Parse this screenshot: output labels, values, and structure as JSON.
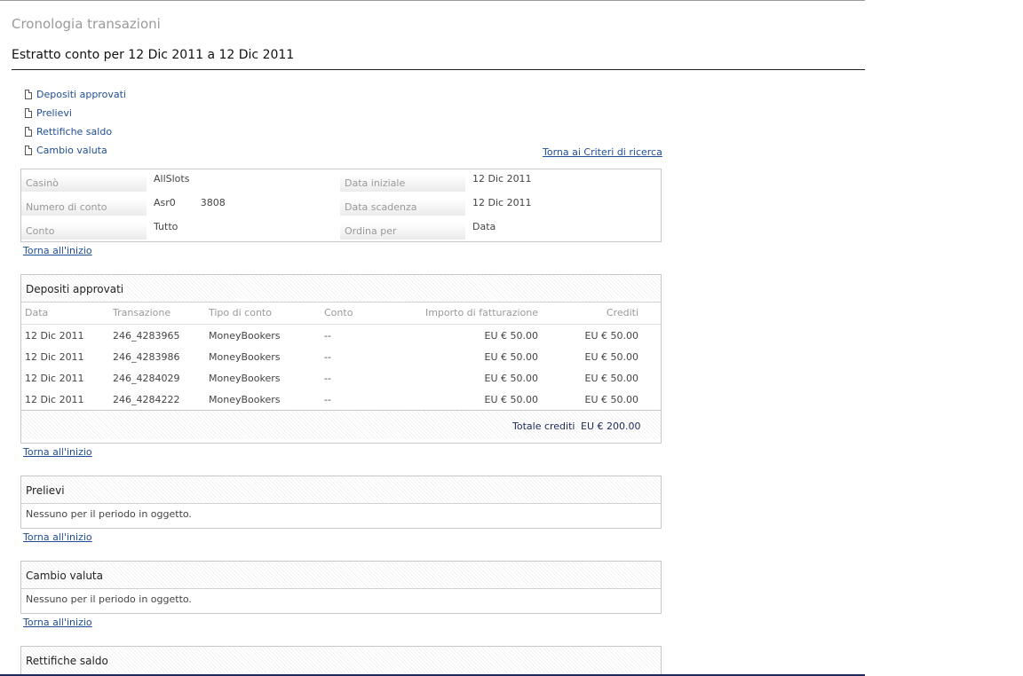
{
  "header": {
    "app_title": "Cronologia transazioni",
    "statement_title": "Estratto conto per 12 Dic 2011 a 12 Dic 2011"
  },
  "section_links": [
    {
      "label": "Depositi approvati",
      "icon": "document-icon"
    },
    {
      "label": "Prelievi",
      "icon": "document-icon"
    },
    {
      "label": "Rettifiche saldo",
      "icon": "document-icon"
    },
    {
      "label": "Cambio valuta",
      "icon": "document-icon"
    }
  ],
  "back_to_criteria": "Torna ai Criteri di ricerca",
  "back_to_top": "Torna all'inizio",
  "criteria": {
    "casino_label": "Casinò",
    "casino_value": "AllSlots",
    "start_label": "Data iniziale",
    "start_value": "12 Dic 2011",
    "account_number_label": "Numero di conto",
    "account_number_value": "Asr0        3808",
    "end_label": "Data scadenza",
    "end_value": "12 Dic 2011",
    "account_label": "Conto",
    "account_value": "Tutto",
    "order_label": "Ordina per",
    "order_value": "Data"
  },
  "deposits": {
    "title": "Depositi approvati",
    "columns": [
      "Data",
      "Transazione",
      "Tipo di conto",
      "Conto",
      "Importo di fatturazione",
      "Crediti"
    ],
    "rows": [
      [
        "12 Dic 2011",
        "246_4283965",
        "MoneyBookers",
        "--",
        "EU € 50.00",
        "EU € 50.00"
      ],
      [
        "12 Dic 2011",
        "246_4283986",
        "MoneyBookers",
        "--",
        "EU € 50.00",
        "EU € 50.00"
      ],
      [
        "12 Dic 2011",
        "246_4284029",
        "MoneyBookers",
        "--",
        "EU € 50.00",
        "EU € 50.00"
      ],
      [
        "12 Dic 2011",
        "246_4284222",
        "MoneyBookers",
        "--",
        "EU € 50.00",
        "EU € 50.00"
      ]
    ],
    "total_label": "Totale crediti",
    "total_value": "EU € 200.00"
  },
  "withdrawals": {
    "title": "Prelievi",
    "empty": "Nessuno per il periodo in oggetto."
  },
  "exchange": {
    "title": "Cambio valuta",
    "empty": "Nessuno per il periodo in oggetto."
  },
  "adjustments": {
    "title": "Rettifiche saldo"
  }
}
